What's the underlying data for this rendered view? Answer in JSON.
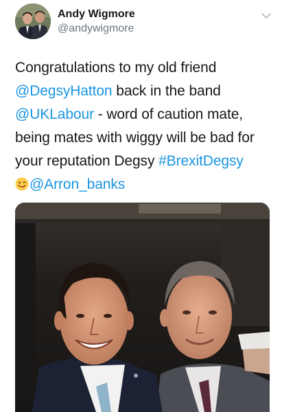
{
  "tweet": {
    "author": {
      "display_name": "Andy Wigmore",
      "handle": "@andywigmore",
      "avatar_icon": "profile-photo-two-men"
    },
    "menu_icon": "chevron-down-icon",
    "text": {
      "line1": "Congratulations to my old friend",
      "mention1": "@DegsyHatton",
      "line2_rest": " back in the band",
      "mention2": "@UKLabour",
      "line3_rest": " - word of caution mate,",
      "line4": "being mates with wiggy will be bad for",
      "line5_start": "your reputation Degsy ",
      "hashtag": "#BrexitDegsy",
      "emoji": "winking-face-with-tongue",
      "mention3": "@Arron_banks"
    },
    "media": {
      "description_icon": "selfie-photo-two-men"
    }
  },
  "colors": {
    "link": "#1b95e0",
    "text": "#14171a",
    "secondary": "#657786"
  }
}
